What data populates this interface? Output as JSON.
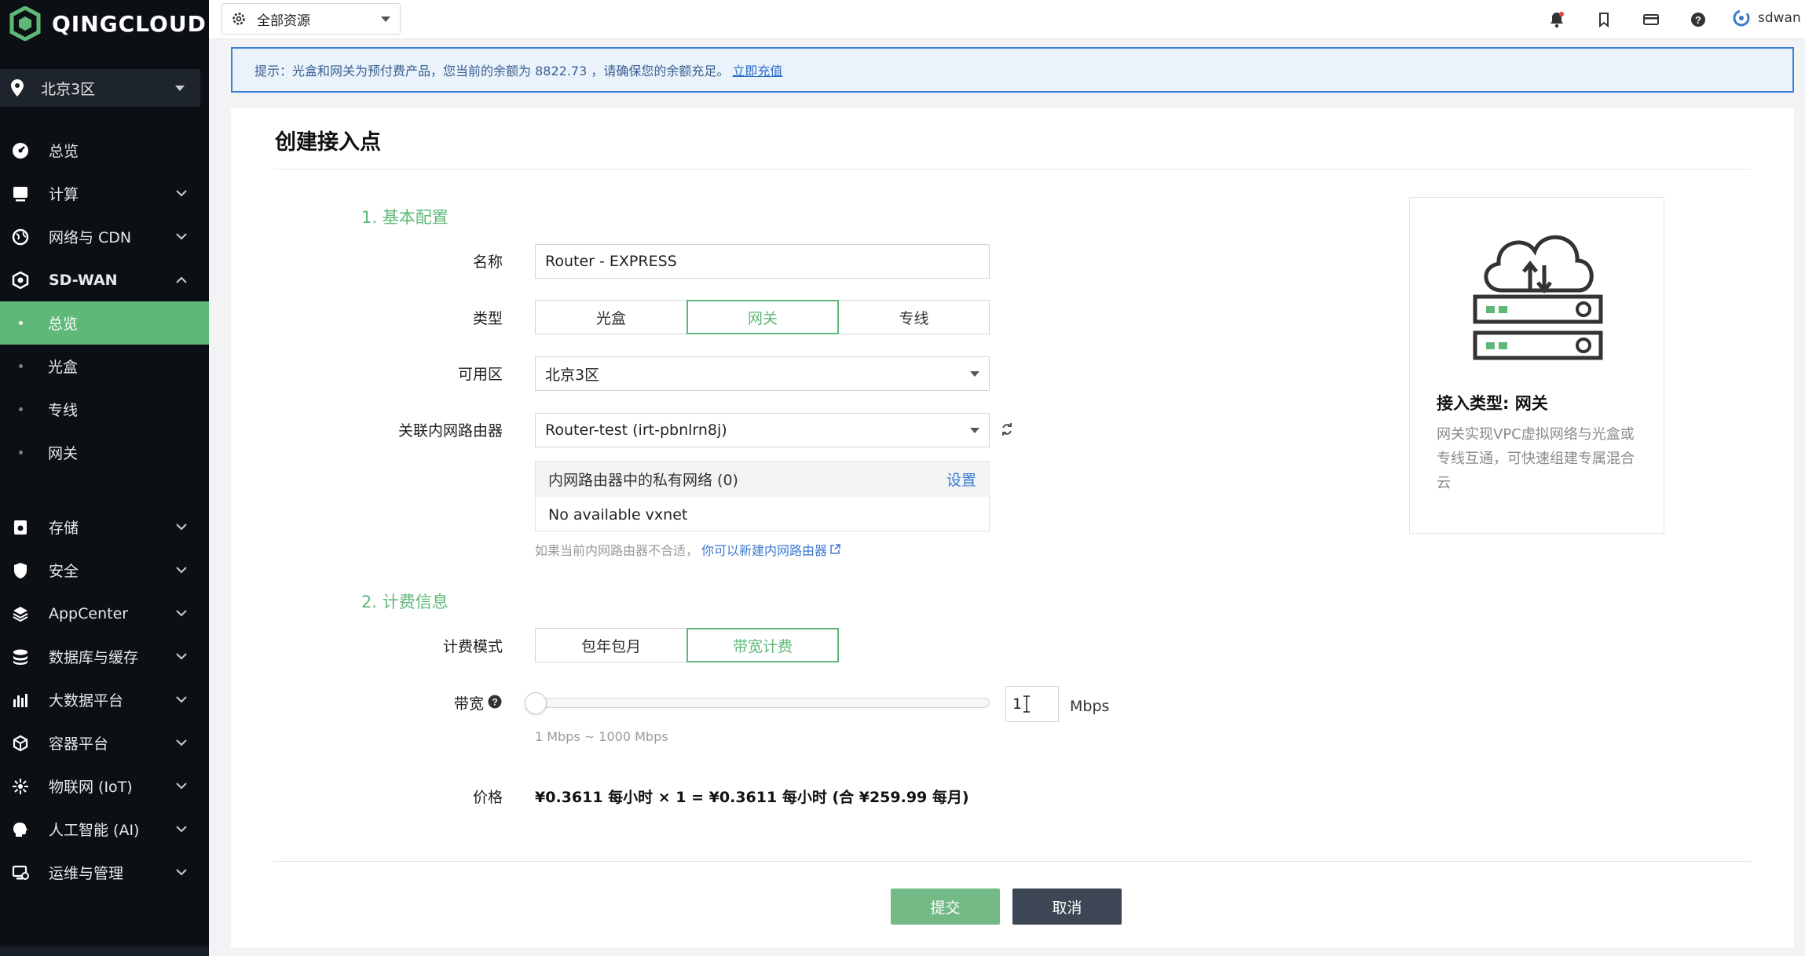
{
  "brand": {
    "name": "QINGCLOUD",
    "logo_icon": "qingcloud-logo-icon"
  },
  "sidebar": {
    "region": "北京3区",
    "items": [
      {
        "label": "总览",
        "icon": "dashboard-icon"
      },
      {
        "label": "计算",
        "icon": "monitor-icon"
      },
      {
        "label": "网络与 CDN",
        "icon": "globe-icon"
      },
      {
        "label": "SD-WAN",
        "icon": "sdwan-icon"
      }
    ],
    "sdwan_children": [
      "总览",
      "光盒",
      "专线",
      "网关"
    ],
    "items2": [
      {
        "label": "存储",
        "icon": "storage-icon"
      },
      {
        "label": "安全",
        "icon": "shield-icon"
      },
      {
        "label": "AppCenter",
        "icon": "layers-icon"
      },
      {
        "label": "数据库与缓存",
        "icon": "database-icon"
      },
      {
        "label": "大数据平台",
        "icon": "bar-chart-icon"
      },
      {
        "label": "容器平台",
        "icon": "cube-icon"
      },
      {
        "label": "物联网 (IoT)",
        "icon": "iot-icon"
      },
      {
        "label": "人工智能 (AI)",
        "icon": "ai-head-icon"
      },
      {
        "label": "运维与管理",
        "icon": "ops-icon"
      }
    ]
  },
  "topbar": {
    "resource_select": "全部资源",
    "username": "sdwan"
  },
  "notice": {
    "text": "提示：光盒和网关为预付费产品，您当前的余额为 8822.73 ，请确保您的余额充足。",
    "link": "立即充值"
  },
  "page": {
    "title": "创建接入点"
  },
  "basic": {
    "section_title": "1. 基本配置",
    "name_label": "名称",
    "name_value": "Router - EXPRESS",
    "type_label": "类型",
    "type_options": [
      "光盒",
      "网关",
      "专线"
    ],
    "type_selected": "网关",
    "zone_label": "可用区",
    "zone_value": "北京3区",
    "router_label": "关联内网路由器",
    "router_value": "Router-test (irt-pbnlrn8j)",
    "vxnet_header": "内网路由器中的私有网络 (0)",
    "vxnet_link": "设置",
    "vxnet_empty": "No available vxnet",
    "router_hint": "如果当前内网路由器不合适，",
    "router_hint_link": "你可以新建内网路由器"
  },
  "billing": {
    "section_title": "2. 计费信息",
    "mode_label": "计费模式",
    "mode_options": [
      "包年包月",
      "带宽计费"
    ],
    "mode_selected": "带宽计费",
    "bandwidth_label": "带宽",
    "bandwidth_value": "1",
    "bandwidth_unit": "Mbps",
    "bandwidth_range": "1 Mbps ~ 1000 Mbps",
    "price_label": "价格",
    "price_value": "¥0.3611 每小时 × 1 = ¥0.3611 每小时 (合 ¥259.99 每月)"
  },
  "actions": {
    "submit": "提交",
    "cancel": "取消"
  },
  "info_card": {
    "title": "接入类型: 网关",
    "desc": "网关实现VPC虚拟网络与光盒或专线互通，可快速组建专属混合云"
  },
  "colors": {
    "accent_green": "#5fb878",
    "notice_border": "#3e7fd6",
    "sidebar_bg": "#0c1015"
  }
}
